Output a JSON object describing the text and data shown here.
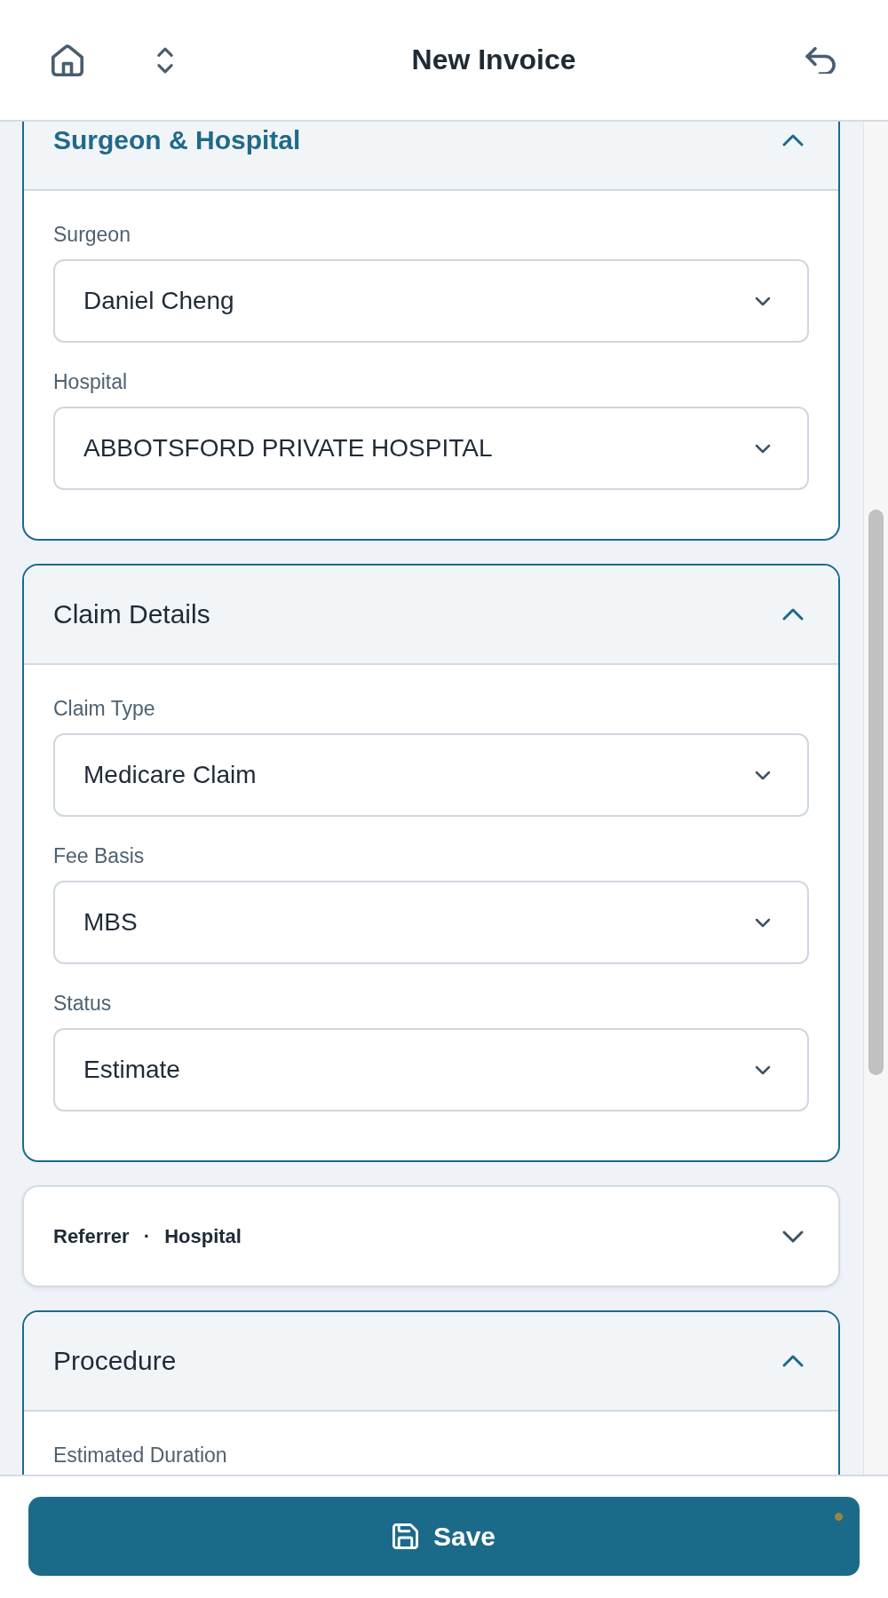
{
  "header": {
    "title": "New Invoice"
  },
  "sections": [
    {
      "title": "Surgeon & Hospital",
      "expanded": true,
      "active": true,
      "fields": [
        {
          "label": "Surgeon",
          "value": "Daniel Cheng"
        },
        {
          "label": "Hospital",
          "value": "ABBOTSFORD PRIVATE HOSPITAL"
        }
      ]
    },
    {
      "title": "Claim Details",
      "expanded": true,
      "active": false,
      "fields": [
        {
          "label": "Claim Type",
          "value": "Medicare Claim"
        },
        {
          "label": "Fee Basis",
          "value": "MBS"
        },
        {
          "label": "Status",
          "value": "Estimate"
        }
      ]
    },
    {
      "title": "Referrer · Hospital",
      "expanded": false,
      "active": false
    },
    {
      "title": "Procedure",
      "expanded": true,
      "active": false,
      "fields": [
        {
          "label": "Estimated Duration"
        }
      ]
    }
  ],
  "footer": {
    "save_button": {
      "label": "Save"
    }
  }
}
